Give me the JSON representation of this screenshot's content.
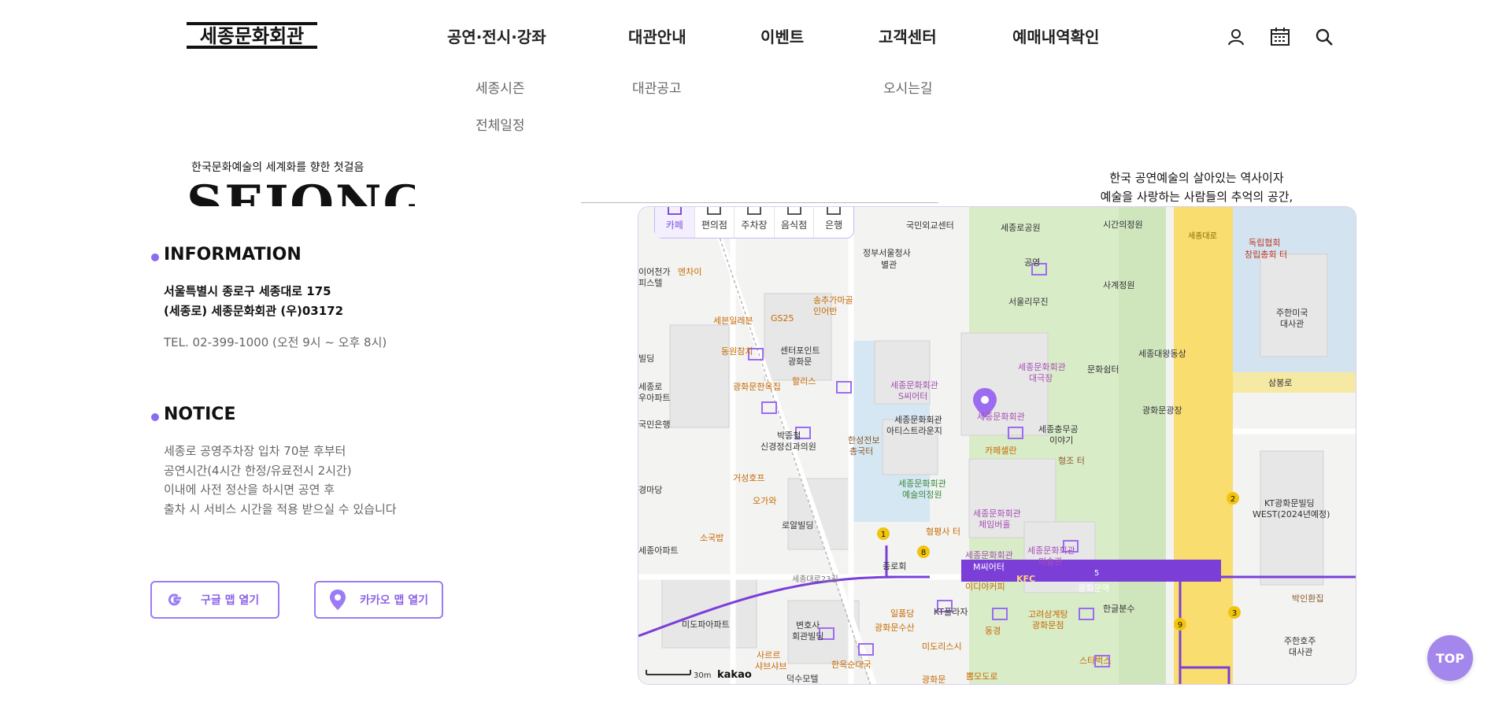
{
  "header": {
    "logo_text": "세종문화회관",
    "nav": [
      {
        "label": "공연·전시·강좌",
        "sub": [
          "세종시즌",
          "전체일정"
        ]
      },
      {
        "label": "대관안내",
        "sub": [
          "대관공고"
        ]
      },
      {
        "label": "이벤트",
        "sub": []
      },
      {
        "label": "고객센터",
        "sub": [
          "오시는길"
        ]
      },
      {
        "label": "예매내역확인",
        "sub": []
      }
    ],
    "icons": [
      "user-icon",
      "calendar-icon",
      "search-icon"
    ]
  },
  "hero": {
    "kicker": "한국문화예술의 세계화를 향한 첫걸음",
    "word": "SEJONG",
    "tagline": [
      "한국 공연예술의 살아있는 역사이자",
      "예술을 사랑하는 사람들의 추억의 공간,"
    ]
  },
  "info": {
    "title": "INFORMATION",
    "address_lines": [
      "서울특별시 종로구 세종대로 175",
      "(세종로) 세종문화회관 (우)03172"
    ],
    "tel": "TEL. 02-399-1000 (오전 9시 ~ 오후 8시)"
  },
  "notice": {
    "title": "NOTICE",
    "lines": [
      "세종로 공영주차장 입차 70분 후부터",
      "공연시간(4시간 한정/유료전시 2시간)",
      "이내에 사전 정산을 하시면 공연 후",
      "출차 시 서비스 시간을 적용 받으실 수 있습니다"
    ]
  },
  "buttons": {
    "google": "구글 맵 열기",
    "kakao": "카카오 맵 열기"
  },
  "map": {
    "categories": [
      "카페",
      "편의점",
      "주차장",
      "음식점",
      "은행"
    ],
    "active_category": "카페",
    "scale_label": "30m",
    "brand": "kakao",
    "labels": {
      "l1": "국민외교센터",
      "l2": "세종로공원",
      "l3": "시간의정원",
      "l4": "독립협회",
      "l5": "창립총회 터",
      "l6": "정부서울청사",
      "l7": "별관",
      "l8": "공영",
      "l9": "서울리무진",
      "l10": "사계정원",
      "l11": "주한미국",
      "l12": "대사관",
      "l13": "송추가마골",
      "l14": "인어반",
      "l15": "세븐일레븐",
      "l16": "GS25",
      "l17": "센터포인트",
      "l18": "광화문",
      "l19": "동원참치",
      "l20": "할리스",
      "l21": "광화문한옥집",
      "l22": "세종문화회관",
      "l23": "S씨어터",
      "l24": "세종문화회관",
      "l25": "대극장",
      "l26": "문화쉼터",
      "l27": "세종대왕동상",
      "l28": "삼봉로",
      "l29": "세종문화회관",
      "l30": "세종문화회관",
      "l31": "아티스트라운지",
      "l32": "세종충무공",
      "l33": "이야기",
      "l34": "광화문광장",
      "l35": "박종철",
      "l36": "신경정신과의원",
      "l37": "한성전보",
      "l38": "총국터",
      "l39": "카페셀란",
      "l40": "형조 터",
      "l41": "거성호프",
      "l42": "세종문화회관",
      "l43": "예술의정원",
      "l44": "KT광화문빌딩",
      "l45": "WEST(2024년예정)",
      "l46": "오가와",
      "l47": "로알빌딩",
      "l48": "세종문화회관",
      "l49": "체임버홀",
      "l50": "소국밥",
      "l51": "형평사 터",
      "l52": "세종아파트",
      "l53": "세종문화회관",
      "l54": "M씨어터",
      "l55": "세종문화회관",
      "l56": "미술관",
      "l57": "종로회",
      "l58": "KFC",
      "l59": "광화문역",
      "l60": "박인환집",
      "l61": "이디야커피",
      "l62": "세종대로23길",
      "l63": "미도파아파트",
      "l64": "일품당",
      "l65": "KT플라자",
      "l66": "광화문수산",
      "l67": "고려삼계탕",
      "l68": "광화문점",
      "l69": "한글분수",
      "l70": "변호사",
      "l71": "회관빌딩",
      "l72": "동경",
      "l73": "주한호주",
      "l74": "대사관",
      "l75": "사르르",
      "l76": "샤브샤브",
      "l77": "미도리스시",
      "l78": "스타벅스",
      "l79": "한옥순대국",
      "l80": "덕수모텔",
      "l81": "뽐모도로",
      "l82": "광화문",
      "l83": "엔차이",
      "l84": "세종로",
      "l85": "우아파트",
      "l86": "국민은행",
      "l87": "경마당",
      "l88": "세종대로",
      "l89": "이어천가",
      "l90": "피스텔",
      "l91": "빌딩"
    },
    "line_numbers": [
      "1",
      "8",
      "5",
      "2",
      "3",
      "9"
    ]
  },
  "top_button": "TOP",
  "colors": {
    "accent": "#8b6cf0",
    "line5": "#7b3fd8",
    "road": "#f9dd6e",
    "park": "#d8ecc8",
    "water": "#cde3f1"
  }
}
